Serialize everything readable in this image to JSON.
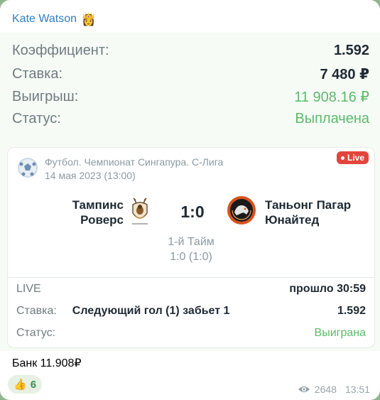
{
  "sender": {
    "name": "Kate Watson",
    "emoji": "👸"
  },
  "bet_summary": {
    "rows": [
      {
        "label": "Коэффициент:",
        "value": "1.592"
      },
      {
        "label": "Ставка:",
        "value": "7 480 ₽"
      },
      {
        "label": "Выигрыш:",
        "value": "11 908.16 ₽"
      },
      {
        "label": "Статус:",
        "value": "Выплачена"
      }
    ]
  },
  "match": {
    "league": "Футбол. Чемпионат Сингапура. С-Лига",
    "date": "14 мая 2023 (13:00)",
    "live_badge": "Live",
    "team_home_line1": "Тампинс",
    "team_home_line2": "Роверс",
    "team_away_line1": "Таньонг Пагар",
    "team_away_line2": "Юнайтед",
    "score": "1:0",
    "period": "1-й Тайм",
    "period_score": "1:0 (1:0)",
    "live_label": "LIVE",
    "elapsed": "прошло 30:59",
    "bet_label": "Ставка:",
    "bet_desc": "Следующий гол (1) забьет 1",
    "bet_odds": "1.592",
    "status_label": "Статус:",
    "status_value": "Выиграна"
  },
  "bank_text": "Банк 11.908₽",
  "reaction": {
    "emoji": "👍",
    "count": "6"
  },
  "views": "2648",
  "time": "13:51",
  "colors": {
    "accent_blue": "#2f7fc0",
    "win_green": "#5cba6a",
    "live_red": "#e2453c"
  }
}
